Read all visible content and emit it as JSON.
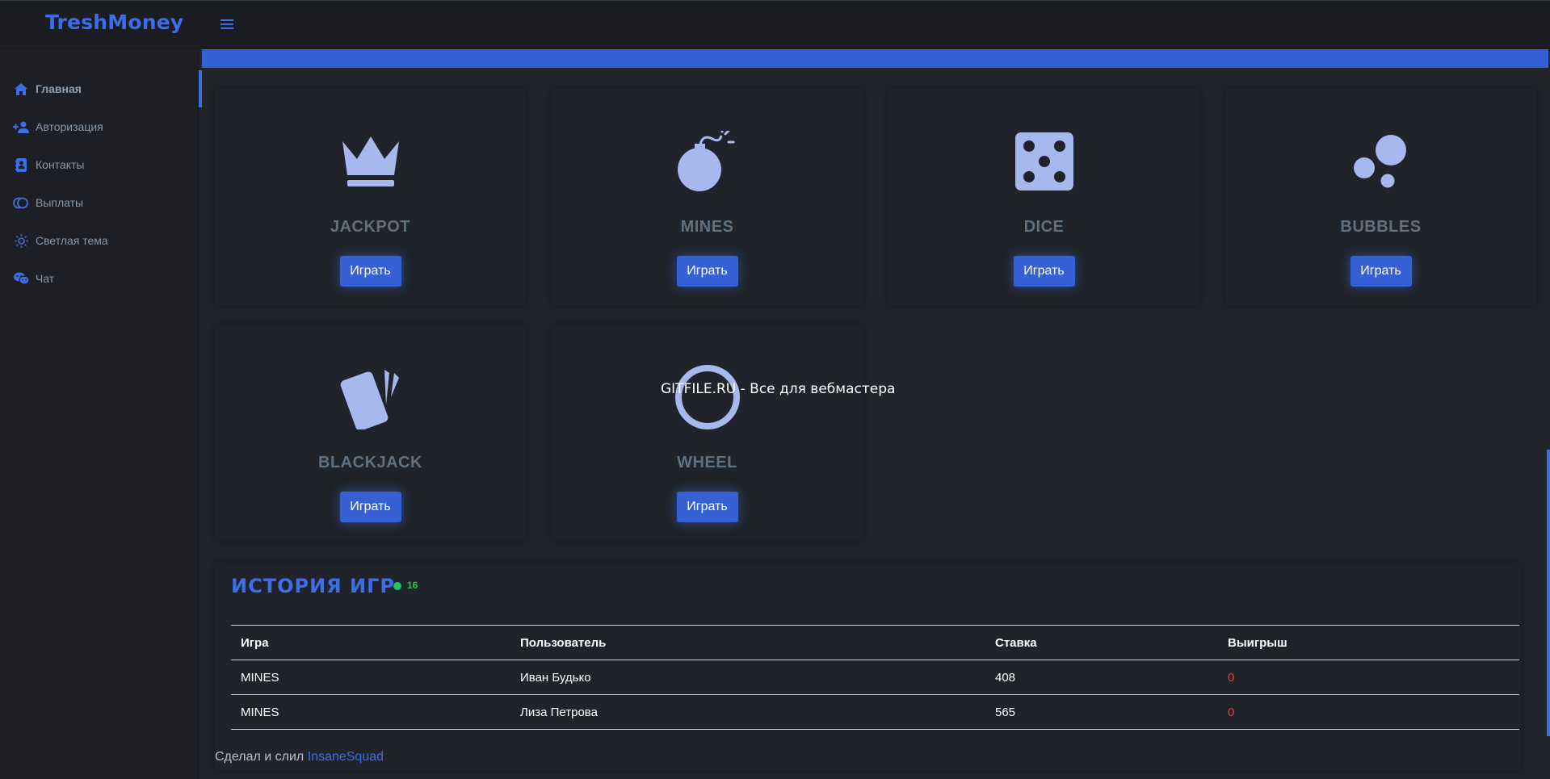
{
  "app": {
    "logo": "TreshMoney",
    "accent": "#3d6ee8"
  },
  "sidebar": {
    "items": [
      {
        "label": "Главная",
        "icon": "home-icon",
        "active": true
      },
      {
        "label": "Авторизация",
        "icon": "user-plus-icon"
      },
      {
        "label": "Контакты",
        "icon": "contact-book-icon"
      },
      {
        "label": "Выплаты",
        "icon": "coins-icon"
      },
      {
        "label": "Светлая тема",
        "icon": "sun-icon"
      },
      {
        "label": "Чат",
        "icon": "chat-icon"
      }
    ]
  },
  "games": [
    {
      "name": "JACKPOT",
      "icon": "crown-icon",
      "button": "Играть"
    },
    {
      "name": "MINES",
      "icon": "bomb-icon",
      "button": "Играть"
    },
    {
      "name": "DICE",
      "icon": "dice-icon",
      "button": "Играть"
    },
    {
      "name": "BUBBLES",
      "icon": "bubbles-icon",
      "button": "Играть"
    },
    {
      "name": "BLACKJACK",
      "icon": "cards-icon",
      "button": "Играть"
    },
    {
      "name": "WHEEL",
      "icon": "wheel-icon",
      "button": "Играть"
    }
  ],
  "watermark": "GITFILE.RU - Все для вебмастера",
  "history": {
    "title": "ИСТОРИЯ ИГР",
    "online_count": "16",
    "columns": [
      "Игра",
      "Пользователь",
      "Ставка",
      "Выигрыш"
    ],
    "rows": [
      {
        "game": "MINES",
        "user": "Иван Будько",
        "bet": "408",
        "win": "0"
      },
      {
        "game": "MINES",
        "user": "Лиза Петрова",
        "bet": "565",
        "win": "0"
      }
    ]
  },
  "footer": {
    "text": "Сделал и слил",
    "link": "InsaneSquad"
  }
}
